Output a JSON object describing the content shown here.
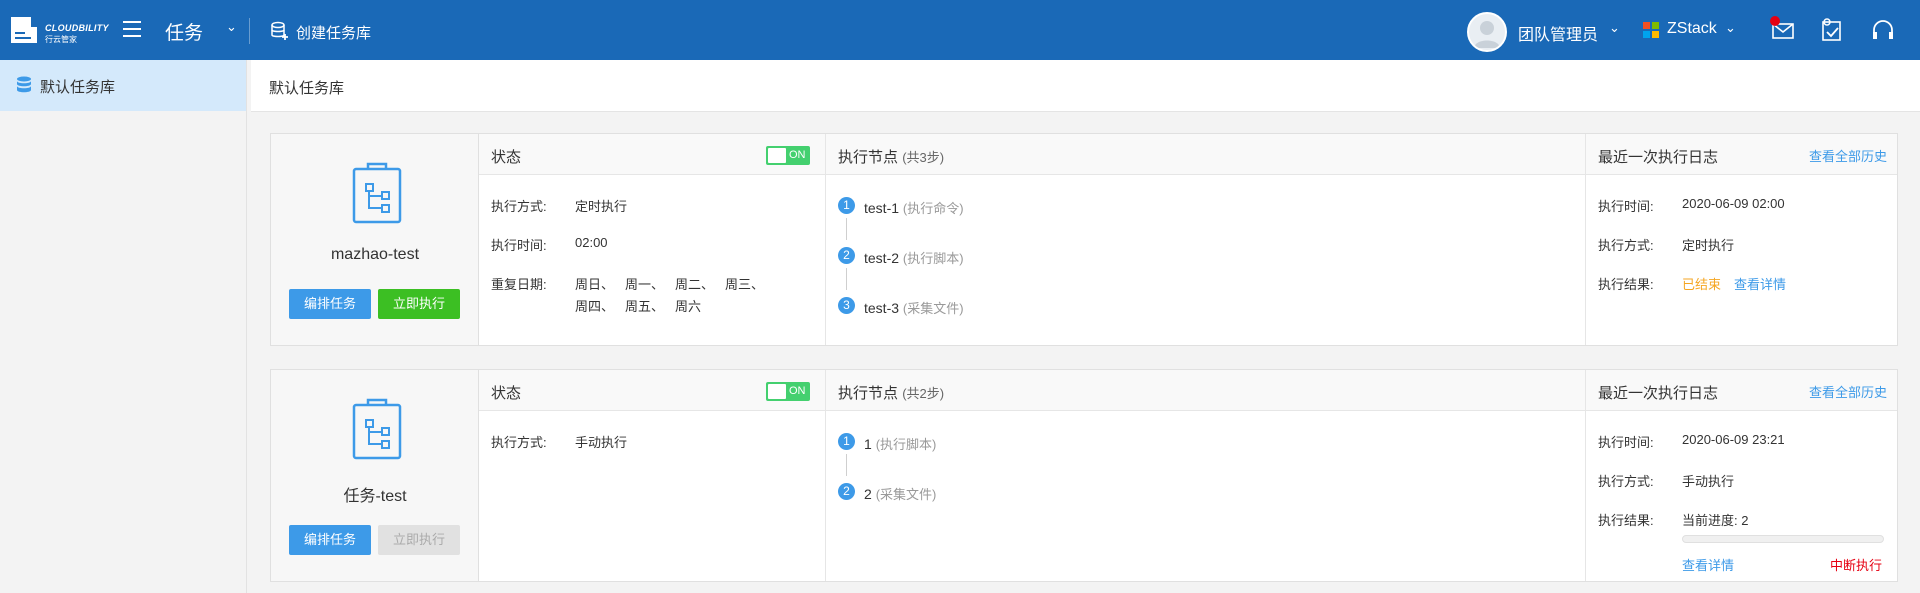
{
  "topbar": {
    "brand": "CLOUDBILITY",
    "brand_sub": "行云管家",
    "app_title": "任务",
    "create_lib": "创建任务库",
    "user_name": "团队管理员",
    "org_name": "ZStack",
    "colors": {
      "bar": "#1a69b7",
      "badge": "#e60012"
    },
    "icons": [
      "menu-icon",
      "database-add-icon",
      "mail-icon",
      "task-check-icon",
      "headset-icon"
    ]
  },
  "sidebar": {
    "items": [
      {
        "label": "默认任务库",
        "icon": "database-icon",
        "active": true
      }
    ]
  },
  "main": {
    "title": "默认任务库",
    "labels": {
      "status": "状态",
      "toggle_on": "ON",
      "exec_nodes": "执行节点",
      "recent_log": "最近一次执行日志",
      "view_all_history": "查看全部历史",
      "exec_mode": "执行方式:",
      "exec_time": "执行时间:",
      "repeat_days": "重复日期:",
      "exec_result": "执行结果:",
      "edit_task": "编排任务",
      "run_now": "立即执行",
      "view_detail": "查看详情"
    },
    "tasks": [
      {
        "name": "mazhao-test",
        "exec_mode": "定时执行",
        "exec_time": "02:00",
        "repeat_days": [
          "周日、",
          "周一、",
          "周二、",
          "周三、",
          "周四、",
          "周五、",
          "周六"
        ],
        "steps_count": "(共3步)",
        "steps": [
          {
            "num": "1",
            "name": "test-1",
            "type": "(执行命令)"
          },
          {
            "num": "2",
            "name": "test-2",
            "type": "(执行脚本)"
          },
          {
            "num": "3",
            "name": "test-3",
            "type": "(采集文件)"
          }
        ],
        "log": {
          "time": "2020-06-09 02:00",
          "mode": "定时执行",
          "result": "已结束"
        },
        "run_enabled": true
      },
      {
        "name": "任务-test",
        "exec_mode": "手动执行",
        "steps_count": "(共2步)",
        "steps": [
          {
            "num": "1",
            "name": "1",
            "type": "(执行脚本)"
          },
          {
            "num": "2",
            "name": "2",
            "type": "(采集文件)"
          }
        ],
        "log": {
          "time": "2020-06-09 23:21",
          "mode": "手动执行",
          "result_prefix": "当前进度:",
          "progress_value": "2",
          "interrupt": "中断执行"
        },
        "run_enabled": false
      }
    ]
  }
}
